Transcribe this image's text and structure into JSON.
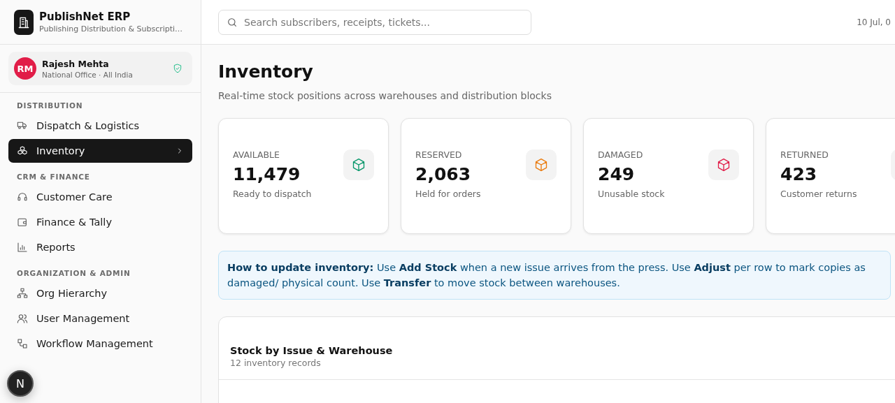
{
  "brand": {
    "name": "PublishNet ERP",
    "tagline": "Publishing Distribution & Subscripti…"
  },
  "user": {
    "initials": "RM",
    "name": "Rajesh Mehta",
    "office": "National Office · All India"
  },
  "sidebar": {
    "sections": [
      {
        "label": "DISTRIBUTION",
        "items": [
          {
            "label": "Dispatch & Logistics",
            "selected": false
          },
          {
            "label": "Inventory",
            "selected": true
          }
        ]
      },
      {
        "label": "CRM & FINANCE",
        "items": [
          {
            "label": "Customer Care",
            "selected": false
          },
          {
            "label": "Finance & Tally",
            "selected": false
          },
          {
            "label": "Reports",
            "selected": false
          }
        ]
      },
      {
        "label": "ORGANIZATION & ADMIN",
        "items": [
          {
            "label": "Org Hierarchy",
            "selected": false
          },
          {
            "label": "User Management",
            "selected": false
          },
          {
            "label": "Workflow Management",
            "selected": false
          }
        ]
      }
    ]
  },
  "floating_button": {
    "label": "N"
  },
  "search": {
    "placeholder": "Search subscribers, receipts, tickets..."
  },
  "date": "10 Jul, 0",
  "page": {
    "title": "Inventory",
    "subtitle": "Real-time stock positions across warehouses and distribution blocks"
  },
  "cards": [
    {
      "label": "AVAILABLE",
      "value": "11,479",
      "note": "Ready to dispatch",
      "color": "#059669"
    },
    {
      "label": "RESERVED",
      "value": "2,063",
      "note": "Held for orders",
      "color": "#ea7a0c"
    },
    {
      "label": "DAMAGED",
      "value": "249",
      "note": "Unusable stock",
      "color": "#e11d48"
    },
    {
      "label": "RETURNED",
      "value": "423",
      "note": "Customer returns"
    }
  ],
  "info": "**How to update inventory:** Use **Add Stock** when a new issue arrives from the press. Use **Adjust** per row to mark copies as damaged/ physical count. Use **Transfer** to move stock between warehouses.",
  "table": {
    "title": "Stock by Issue & Warehouse",
    "subtitle": "12 inventory records"
  }
}
